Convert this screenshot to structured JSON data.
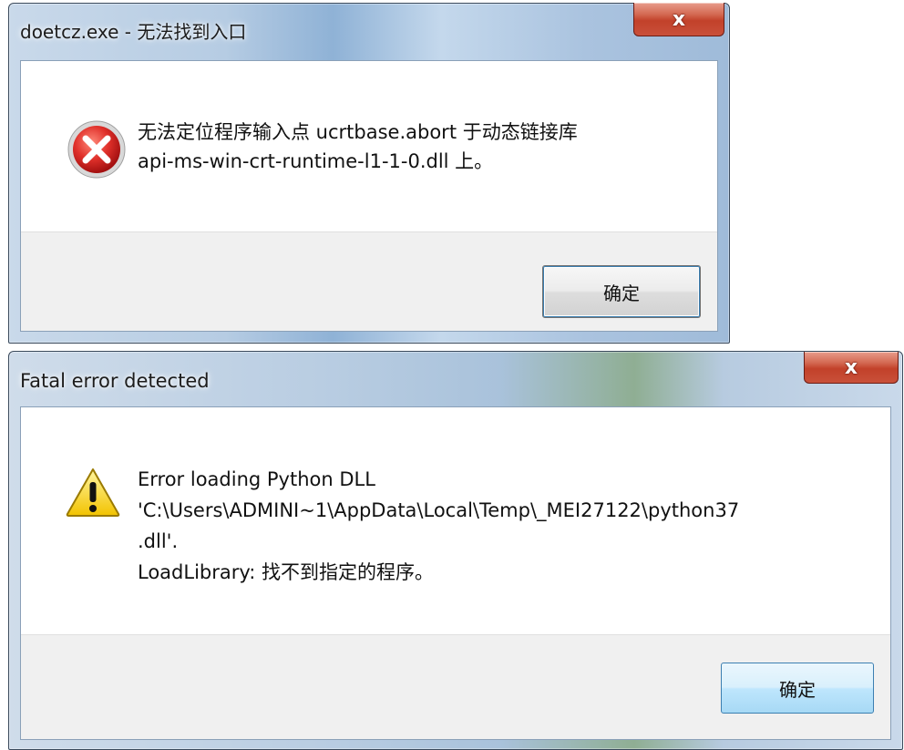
{
  "dialog1": {
    "title": "doetcz.exe - 无法找到入口",
    "close_label": "x",
    "icon": "error-icon",
    "message_lines": [
      "无法定位程序输入点 ucrtbase.abort 于动态链接库",
      "api-ms-win-crt-runtime-l1-1-0.dll 上。"
    ],
    "ok_label": "确定"
  },
  "dialog2": {
    "title": "Fatal error detected",
    "close_label": "x",
    "icon": "warning-icon",
    "message_lines": [
      "Error loading Python DLL",
      "'C:\\Users\\ADMINI~1\\AppData\\Local\\Temp\\_MEI27122\\python37",
      ".dll'.",
      "LoadLibrary: 找不到指定的程序。"
    ],
    "ok_label": "确定"
  }
}
